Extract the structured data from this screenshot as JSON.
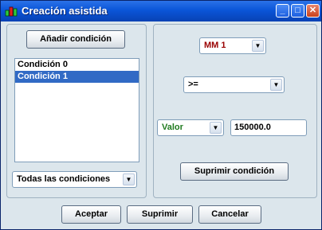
{
  "window": {
    "title": "Creación asistida",
    "controls": {
      "minimize": "_",
      "maximize": "□",
      "close": "✕"
    }
  },
  "left_panel": {
    "add_button": "Añadir condición",
    "conditions": [
      {
        "label": "Condición 0",
        "selected": false
      },
      {
        "label": "Condición 1",
        "selected": true
      }
    ],
    "scope_select": {
      "value": "Todas las condiciones"
    }
  },
  "right_panel": {
    "indicator_select": {
      "value": "MM 1",
      "color": "#990000"
    },
    "operator_select": {
      "value": ">="
    },
    "operand_type_select": {
      "value": "Valor",
      "color": "#1f7a1f"
    },
    "value_input": {
      "value": "150000.0"
    },
    "delete_condition_button": "Suprimir condición"
  },
  "footer": {
    "accept_button": "Aceptar",
    "delete_button": "Suprimir",
    "cancel_button": "Cancelar"
  },
  "icons": {
    "app": "bar-chart-icon",
    "dropdown": "chevron-down-icon"
  }
}
